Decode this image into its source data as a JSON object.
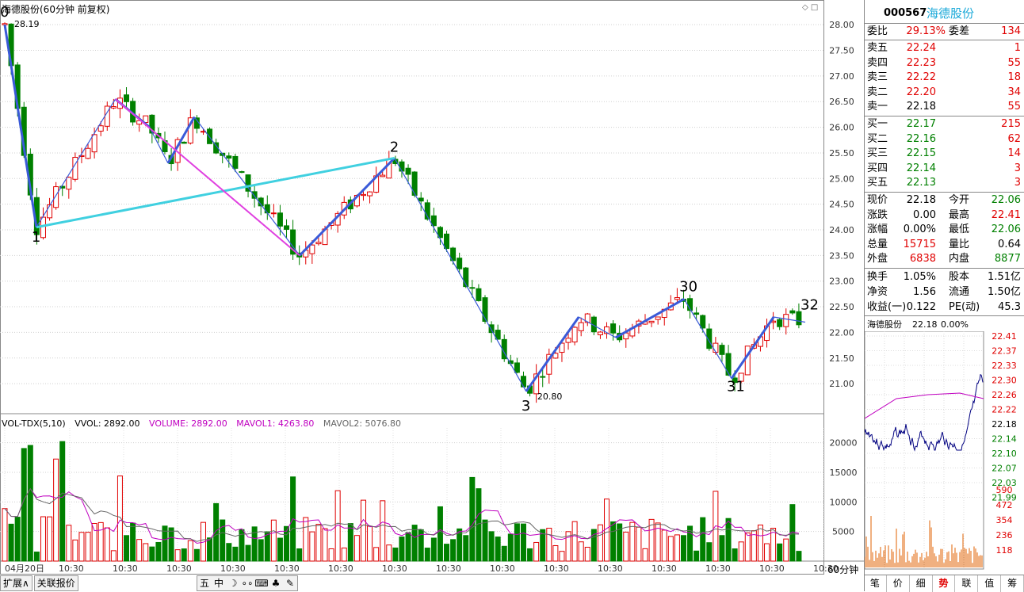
{
  "chart_title": "海德股份(60分钟 前复权)",
  "price_axis": [
    "28.00",
    "27.50",
    "27.00",
    "26.50",
    "26.00",
    "25.50",
    "25.00",
    "24.50",
    "24.00",
    "23.50",
    "23.00",
    "22.50",
    "22.00",
    "21.50",
    "21.00"
  ],
  "vol_axis": [
    "20000",
    "15000",
    "10000",
    "5000"
  ],
  "time_axis": [
    "04月20日",
    "10:30",
    "10:30",
    "10:30",
    "10:30",
    "10:30",
    "10:30",
    "10:30",
    "10:30",
    "10:30",
    "10:30",
    "10:30",
    "10:30",
    "10:30",
    "10:30",
    "10:30"
  ],
  "labels": {
    "max_price": "28.19",
    "min_price": "20.80",
    "wave": [
      "0",
      "1",
      "2",
      "3",
      "30",
      "31",
      "32"
    ]
  },
  "indicator": {
    "name": "VOL-TDX(5,10)",
    "vvol": "VVOL: 2892.00",
    "volume": "VOLUME: 2892.00",
    "mavol1": "MAVOL1: 4263.80",
    "mavol2": "MAVOL2: 5076.80"
  },
  "period": "60分钟",
  "bottom_tabs": [
    "扩展∧",
    "关联报价"
  ],
  "toolbar_icons": [
    "五",
    "中",
    "☽",
    "∘∘",
    "⌨",
    "♣",
    "✎"
  ],
  "quote": {
    "code": "000567",
    "name": "海德股份",
    "weibi_label": "委比",
    "weibi": "29.13%",
    "weicha_label": "委差",
    "weicha": "134",
    "asks": [
      {
        "label": "卖五",
        "price": "22.24",
        "vol": "1"
      },
      {
        "label": "卖四",
        "price": "22.23",
        "vol": "55"
      },
      {
        "label": "卖三",
        "price": "22.22",
        "vol": "18"
      },
      {
        "label": "卖二",
        "price": "22.20",
        "vol": "34"
      },
      {
        "label": "卖一",
        "price": "22.18",
        "vol": "55"
      }
    ],
    "bids": [
      {
        "label": "买一",
        "price": "22.17",
        "vol": "215"
      },
      {
        "label": "买二",
        "price": "22.16",
        "vol": "62"
      },
      {
        "label": "买三",
        "price": "22.15",
        "vol": "14"
      },
      {
        "label": "买四",
        "price": "22.14",
        "vol": "3"
      },
      {
        "label": "买五",
        "price": "22.13",
        "vol": "3"
      }
    ],
    "stats": [
      {
        "l1": "现价",
        "v1": "22.18",
        "l2": "今开",
        "v2": "22.06"
      },
      {
        "l1": "涨跌",
        "v1": "0.00",
        "l2": "最高",
        "v2": "22.41"
      },
      {
        "l1": "涨幅",
        "v1": "0.00%",
        "l2": "最低",
        "v2": "22.06"
      },
      {
        "l1": "总量",
        "v1": "15715",
        "l2": "量比",
        "v2": "0.64"
      },
      {
        "l1": "外盘",
        "v1": "6838",
        "l2": "内盘",
        "v2": "8877"
      }
    ],
    "stats2": [
      {
        "l1": "换手",
        "v1": "1.05%",
        "l2": "股本",
        "v2": "1.51亿"
      },
      {
        "l1": "净资",
        "v1": "1.56",
        "l2": "流通",
        "v2": "1.50亿"
      },
      {
        "l1": "收益(一)",
        "v1": "0.122",
        "l2": "PE(动)",
        "v2": "45.3"
      }
    ],
    "mini_title": "海德股份",
    "mini_price": "22.18",
    "mini_pct": "0.00%",
    "mini_axis": [
      "22.41",
      "22.37",
      "22.33",
      "22.30",
      "22.26",
      "22.22",
      "22.18",
      "22.14",
      "22.10",
      "22.07",
      "22.03",
      "21.99"
    ],
    "mini_vol_axis": [
      "590",
      "472",
      "354",
      "236",
      "118"
    ]
  },
  "right_tabs": [
    "笔",
    "价",
    "细",
    "势",
    "联",
    "值",
    "筹"
  ]
}
